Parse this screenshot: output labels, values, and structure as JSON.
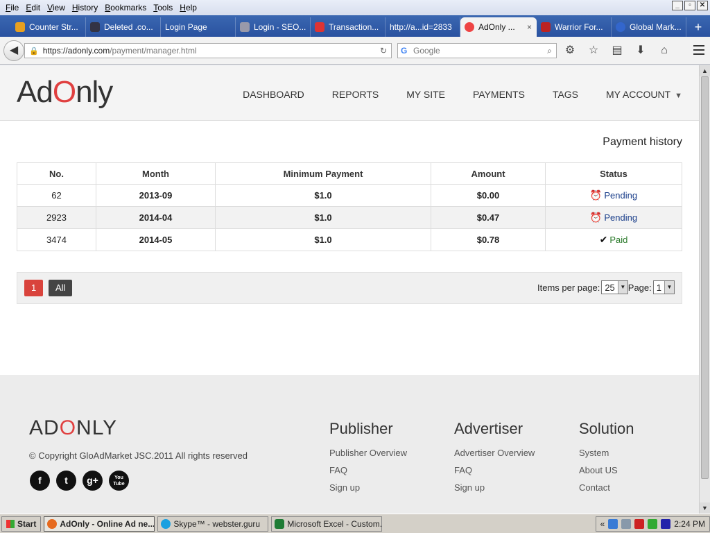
{
  "browser": {
    "menu": [
      "File",
      "Edit",
      "View",
      "History",
      "Bookmarks",
      "Tools",
      "Help"
    ],
    "tabs": [
      {
        "label": "Counter Str...",
        "color": "#e8a020"
      },
      {
        "label": "Deleted .co...",
        "color": "#334"
      },
      {
        "label": "Login Page",
        "color": ""
      },
      {
        "label": "Login - SEO...",
        "color": "#99a"
      },
      {
        "label": "Transaction...",
        "color": "#d33"
      },
      {
        "label": "http://a...id=2833",
        "color": ""
      },
      {
        "label": "AdOnly ...",
        "color": "#e44"
      },
      {
        "label": "Warrior For...",
        "color": "#b22"
      },
      {
        "label": "Global Mark...",
        "color": "#3366cc"
      }
    ],
    "active_tab_close": "×",
    "new_tab": "+",
    "url_host": "https://adonly.com",
    "url_path": "/payment/manager.html",
    "search_placeholder": "Google"
  },
  "site": {
    "logo_pre": "Ad",
    "logo_o": "O",
    "logo_post": "nly",
    "nav": [
      "DASHBOARD",
      "REPORTS",
      "MY SITE",
      "PAYMENTS",
      "TAGS",
      "MY ACCOUNT"
    ],
    "page_title": "Payment history",
    "table": {
      "headers": [
        "No.",
        "Month",
        "Minimum Payment",
        "Amount",
        "Status"
      ],
      "rows": [
        {
          "no": "62",
          "month": "2013-09",
          "min": "$1.0",
          "amount": "$0.00",
          "status": "Pending"
        },
        {
          "no": "2923",
          "month": "2014-04",
          "min": "$1.0",
          "amount": "$0.47",
          "status": "Pending"
        },
        {
          "no": "3474",
          "month": "2014-05",
          "min": "$1.0",
          "amount": "$0.78",
          "status": "Paid"
        }
      ]
    },
    "pager": {
      "page_btn": "1",
      "all_btn": "All",
      "items_label": "Items per page:",
      "items_value": "25",
      "page_label": "Page:",
      "page_value": "1"
    },
    "footer": {
      "logo_pre": "AD",
      "logo_o": "O",
      "logo_post": "NLY",
      "copyright": "© Copyright GloAdMarket JSC.2011 All rights reserved",
      "social": [
        "f",
        "t",
        "g+",
        "You Tube"
      ],
      "columns": [
        {
          "title": "Publisher",
          "links": [
            "Publisher Overview",
            "FAQ",
            "Sign up"
          ]
        },
        {
          "title": "Advertiser",
          "links": [
            "Advertiser Overview",
            "FAQ",
            "Sign up"
          ]
        },
        {
          "title": "Solution",
          "links": [
            "System",
            "About US",
            "Contact"
          ]
        }
      ]
    }
  },
  "taskbar": {
    "start": "Start",
    "tasks": [
      "AdOnly - Online Ad ne...",
      "Skype™ - webster.guru",
      "Microsoft Excel - Custom..."
    ],
    "clock": "2:24 PM",
    "tray_chevron": "«"
  },
  "colors": {
    "accent_red": "#d9433c",
    "pending": "#1a3e8a",
    "paid": "#2a7a2a"
  }
}
